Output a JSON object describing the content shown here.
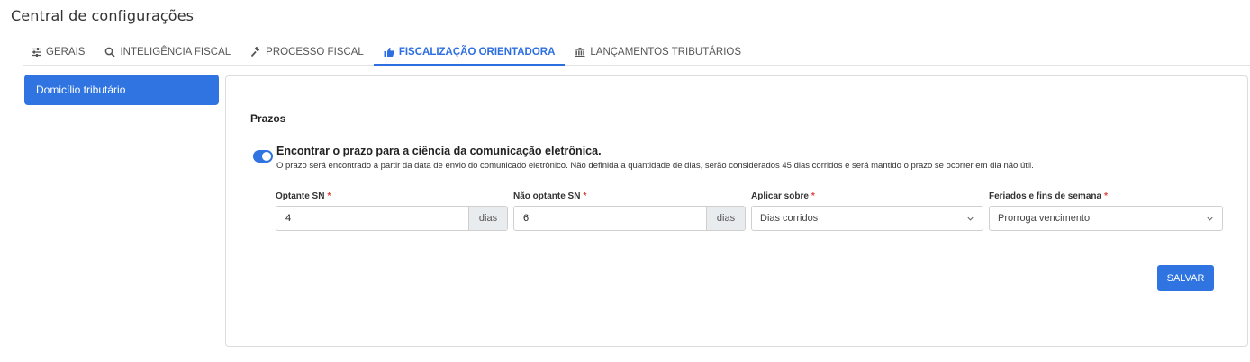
{
  "page": {
    "title": "Central de configurações"
  },
  "tabs": [
    {
      "label": "Gerais",
      "icon": "sliders-icon"
    },
    {
      "label": "Inteligência fiscal",
      "icon": "search-icon"
    },
    {
      "label": "Processo fiscal",
      "icon": "gavel-icon"
    },
    {
      "label": "Fiscalização orientadora",
      "icon": "thumbs-up-icon",
      "active": true
    },
    {
      "label": "Lançamentos tributários",
      "icon": "bank-icon"
    }
  ],
  "sidebar": {
    "items": [
      {
        "label": "Domicílio tributário",
        "active": true
      }
    ]
  },
  "section": {
    "title": "Prazos",
    "toggle_on": true,
    "option_title": "Encontrar o prazo para a ciência da comunicação eletrônica.",
    "option_description": "O prazo será encontrado a partir da data de envio do comunicado eletrônico. Não definida a quantidade de dias, serão considerados 45 dias corridos e será mantido o prazo se ocorrer em dia não útil."
  },
  "fields": {
    "optante": {
      "label": "Optante SN",
      "required": "*",
      "value": "4",
      "addon": "dias"
    },
    "nao_optante": {
      "label": "Não optante SN",
      "required": "*",
      "value": "6",
      "addon": "dias"
    },
    "aplicar": {
      "label": "Aplicar sobre",
      "required": "*",
      "selected": "Dias corridos"
    },
    "feriados": {
      "label": "Feriados e fins de semana",
      "required": "*",
      "selected": "Prorroga vencimento"
    }
  },
  "actions": {
    "save_label": "SALVAR"
  },
  "colors": {
    "accent": "#2f74e0",
    "required": "#e0403a"
  }
}
